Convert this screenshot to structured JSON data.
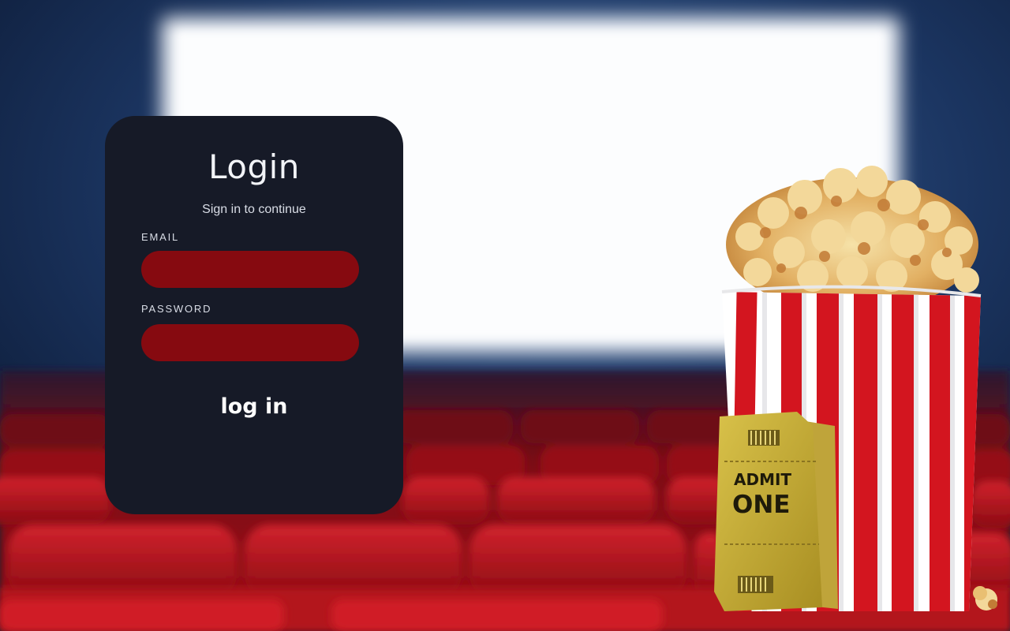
{
  "login": {
    "title": "Login",
    "subtitle": "Sign in to continue",
    "email_label": "EMAIL",
    "email_value": "",
    "password_label": "PASSWORD",
    "password_value": "",
    "submit_label": "log in"
  },
  "background": {
    "ticket_text_line1": "ADMIT",
    "ticket_text_line2": "ONE"
  },
  "colors": {
    "card": "#161a27",
    "input": "#860a10",
    "seat_red": "#b3121c",
    "screen": "#f4f7fb"
  }
}
